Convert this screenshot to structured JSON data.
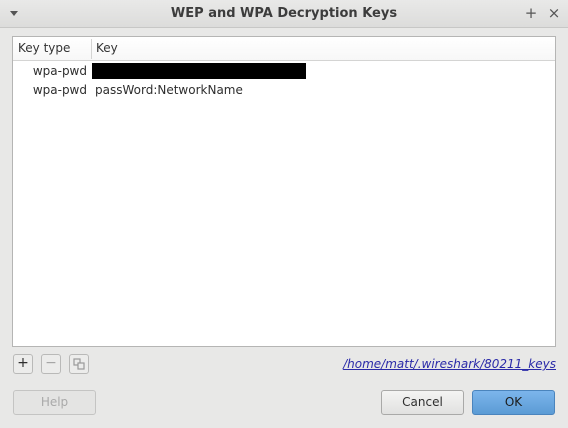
{
  "window": {
    "title": "WEP and WPA Decryption Keys",
    "maximize_glyph": "+",
    "close_glyph": "×"
  },
  "table": {
    "headers": [
      "Key type",
      "Key"
    ],
    "rows": [
      {
        "type": "wpa-pwd",
        "key": "",
        "redacted": true
      },
      {
        "type": "wpa-pwd",
        "key": "passWord:NetworkName",
        "redacted": false
      }
    ]
  },
  "toolbar": {
    "add_glyph": "+",
    "remove_glyph": "−",
    "copy_icon": "copy-icon",
    "file_path": "/home/matt/.wireshark/80211_keys"
  },
  "buttons": {
    "help": "Help",
    "cancel": "Cancel",
    "ok": "OK"
  }
}
